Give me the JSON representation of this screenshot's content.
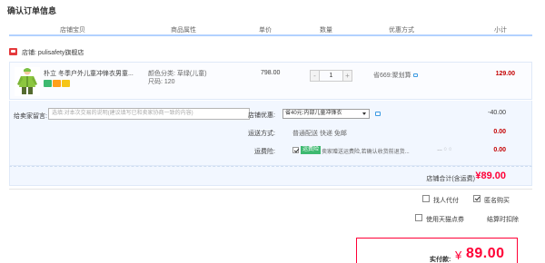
{
  "page_title": "确认订单信息",
  "columns": [
    "店铺宝贝",
    "商品属性",
    "单价",
    "数量",
    "优惠方式",
    "小计"
  ],
  "store": {
    "label": "店铺:",
    "name": "pulisafety旗舰店"
  },
  "item": {
    "title_line1": "朴立 冬季户外儿童冲锋衣男童...",
    "title_line2": "",
    "color_label": "颜色分类: 草绿(儿童)",
    "size_label": "尺码: 120",
    "price": "798.00",
    "quantity": "1",
    "qty_minus": "-",
    "qty_plus": "+",
    "discount": "省669:聚划算",
    "subtotal": "129.00",
    "badge_colors": [
      "#3db970",
      "#ff9f1a",
      "#f5c518"
    ]
  },
  "message": {
    "label": "给卖家留言:",
    "placeholder": "选填:对本次交易的说明(建议填写已和卖家协商一致的内容)"
  },
  "store_discount": {
    "label": "店铺优惠:",
    "selected": "省40元:内部儿童冲锋衣",
    "amount": "-40.00"
  },
  "shipping": {
    "label": "运送方式:",
    "text": "普通配送 快递 免邮",
    "amount": "0.00"
  },
  "insurance": {
    "label": "运费险:",
    "tag": "运费险",
    "text": "卖家赠送运费险,若确认收货前退货...",
    "amount": "0.00"
  },
  "store_total": {
    "label": "店铺合计(含运费)",
    "value": "¥89.00"
  },
  "options": {
    "proxy_pay": "找人代付",
    "anonymous": "匿名购买",
    "tmall_points": "使用天猫点券",
    "tmall_points_value": "结算时扣除"
  },
  "final": {
    "label": "实付款:",
    "symbol": "¥",
    "value": "89.00"
  },
  "colors": {
    "accent_red": "#ff0036",
    "price_red": "#c40000",
    "header_line": "#b2d1ff",
    "panel_bg": "#f2f7ff"
  }
}
